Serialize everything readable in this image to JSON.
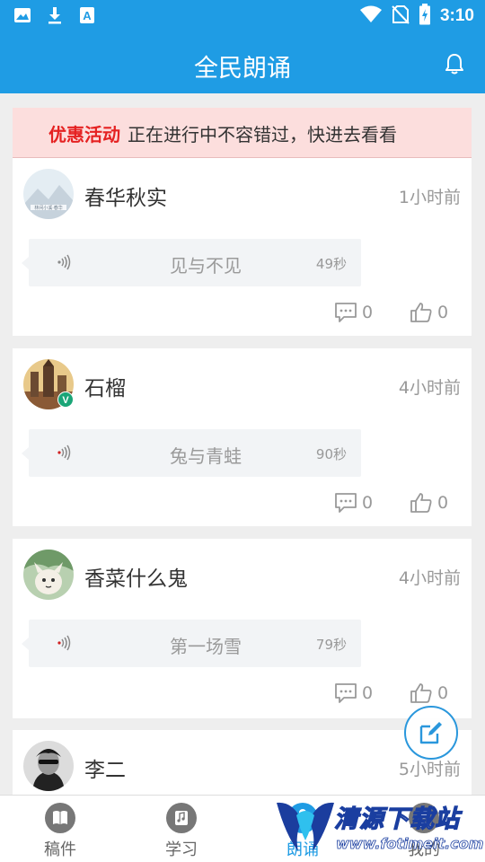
{
  "status_bar": {
    "time": "3:10",
    "left_icons": [
      "image-icon",
      "download-icon",
      "app-a-icon"
    ],
    "right_icons": [
      "wifi-icon",
      "no-sim-icon",
      "battery-charging-icon"
    ]
  },
  "app_bar": {
    "title": "全民朗诵",
    "right_icon": "bell-icon"
  },
  "promo": {
    "tag": "优惠活动",
    "text": "正在进行中不容错过，快进去看看",
    "tag_color": "#e52222",
    "background": "#fcdedd"
  },
  "posts": [
    {
      "user": "春华秋实",
      "time": "1小时前",
      "audio_title": "见与不见",
      "duration": "49秒",
      "comments": "0",
      "likes": "0",
      "avatar_caption": "林间小溪·春华",
      "wave_color": "#8a8a8a"
    },
    {
      "user": "石榴",
      "time": "4小时前",
      "audio_title": "兔与青蛙",
      "duration": "90秒",
      "comments": "0",
      "likes": "0",
      "verified_badge": "V",
      "wave_color": "#d02020"
    },
    {
      "user": "香菜什么鬼",
      "time": "4小时前",
      "audio_title": "第一场雪",
      "duration": "79秒",
      "comments": "0",
      "likes": "0",
      "wave_color": "#d02020"
    },
    {
      "user": "李二",
      "time": "5小时前"
    }
  ],
  "fab": {
    "icon": "edit-icon",
    "color": "#2a97dc"
  },
  "bottom_nav": [
    {
      "label": "稿件",
      "icon": "book-icon",
      "active": false
    },
    {
      "label": "学习",
      "icon": "music-note-icon",
      "active": false
    },
    {
      "label": "朗诵",
      "icon": "microphone-icon",
      "active": true
    },
    {
      "label": "我的",
      "icon": "person-icon",
      "active": false
    }
  ],
  "watermark": {
    "title": "清源下载站",
    "url": "www.fotimeit.com"
  },
  "colors": {
    "primary": "#1f9ce4",
    "background": "#eeeeee",
    "text_muted": "#999999"
  }
}
